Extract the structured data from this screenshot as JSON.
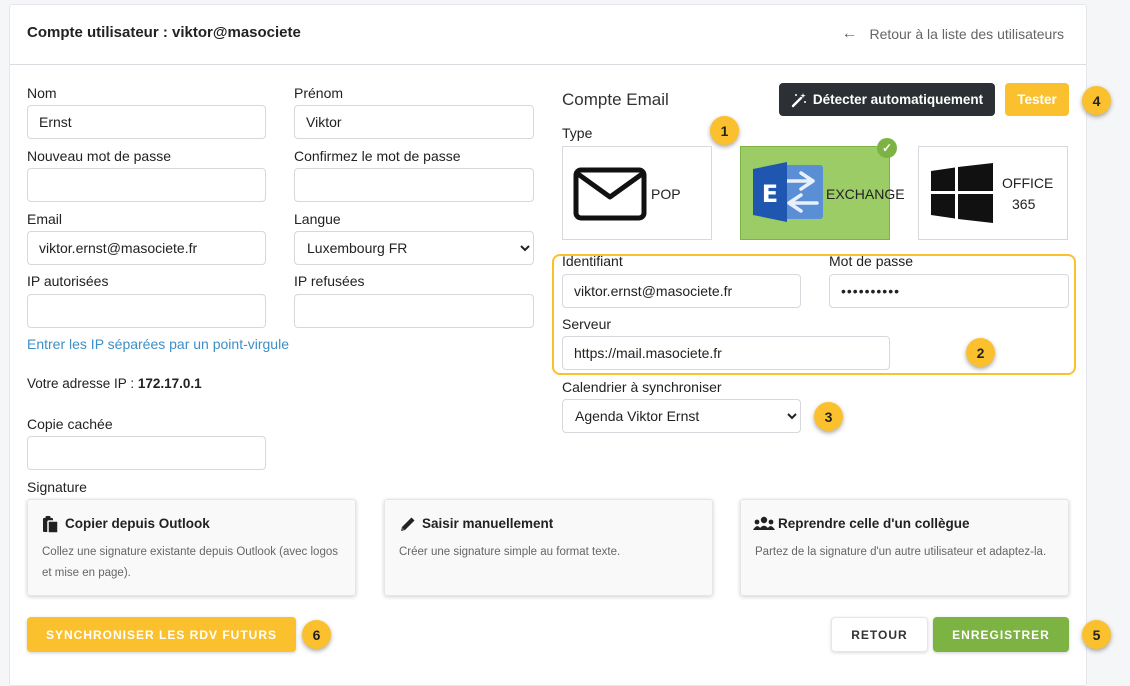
{
  "header": {
    "title": "Compte utilisateur : viktor@masociete",
    "back_link": "Retour à la liste des utilisateurs"
  },
  "form": {
    "nom": {
      "label": "Nom",
      "value": "Ernst"
    },
    "prenom": {
      "label": "Prénom",
      "value": "Viktor"
    },
    "new_password": {
      "label": "Nouveau mot de passe",
      "value": ""
    },
    "confirm_password": {
      "label": "Confirmez le mot de passe",
      "value": ""
    },
    "email": {
      "label": "Email",
      "value": "viktor.ernst@masociete.fr"
    },
    "langue": {
      "label": "Langue",
      "value": "Luxembourg FR"
    },
    "ip_allowed": {
      "label": "IP autorisées",
      "value": ""
    },
    "ip_refused": {
      "label": "IP refusées",
      "value": ""
    },
    "ip_hint": "Entrer les IP séparées par un point-virgule",
    "ip_info_prefix": "Votre adresse IP : ",
    "ip_info_value": "172.17.0.1",
    "copie_cachee": {
      "label": "Copie cachée",
      "value": ""
    },
    "signature_label": "Signature"
  },
  "email_account": {
    "title": "Compte Email",
    "detect_button": "Détecter automatiquement",
    "test_button": "Tester",
    "type_label": "Type",
    "types": [
      {
        "label": "POP",
        "icon": "envelope-icon"
      },
      {
        "label": "EXCHANGE",
        "icon": "exchange-icon",
        "selected": true
      },
      {
        "label_line1": "OFFICE",
        "label_line2": "365",
        "icon": "windows-icon"
      }
    ],
    "identifiant": {
      "label": "Identifiant",
      "value": "viktor.ernst@masociete.fr"
    },
    "mot_de_passe": {
      "label": "Mot de passe",
      "value": "••••••••••"
    },
    "serveur": {
      "label": "Serveur",
      "value": "https://mail.masociete.fr"
    },
    "calendar": {
      "label": "Calendrier à synchroniser",
      "value": "Agenda Viktor Ernst"
    }
  },
  "signature_options": [
    {
      "title": "Copier depuis Outlook",
      "desc": "Collez une signature existante depuis Outlook (avec logos et mise en page).",
      "icon": "clipboard-icon"
    },
    {
      "title": "Saisir manuellement",
      "desc": "Créer une signature simple au format texte.",
      "icon": "pencil-icon"
    },
    {
      "title": "Reprendre celle d'un collègue",
      "desc": "Partez de la signature d'un autre utilisateur et adaptez-la.",
      "icon": "users-icon"
    }
  ],
  "footer": {
    "sync_button": "SYNCHRONISER LES RDV FUTURS",
    "back_button": "RETOUR",
    "save_button": "ENREGISTRER"
  },
  "badges": [
    "1",
    "2",
    "3",
    "4",
    "5",
    "6"
  ],
  "colors": {
    "accent_yellow": "#fbc02d",
    "success_green": "#7cb342",
    "selected_green": "#9ccc65",
    "dark_button": "#2c2f33",
    "link_blue": "#3d8fc7"
  }
}
